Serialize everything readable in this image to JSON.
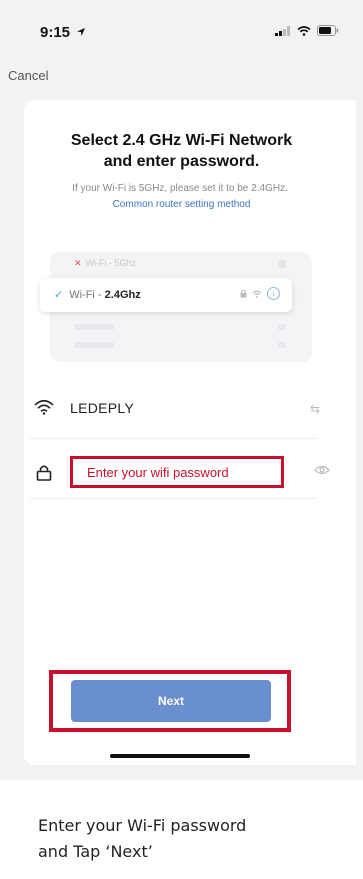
{
  "status_bar": {
    "time": "9:15",
    "location_icon": "location-arrow-icon",
    "signal_icon": "cellular-signal-icon",
    "wifi_icon": "wifi-icon",
    "battery_icon": "battery-icon"
  },
  "nav": {
    "cancel_label": "Cancel"
  },
  "header": {
    "title_line1": "Select 2.4 GHz Wi-Fi Network",
    "title_line2": "and enter password.",
    "subtitle": "If your Wi-Fi is 5GHz, please set it to be 2.4GHz.",
    "router_link": "Common router setting method"
  },
  "illustration": {
    "row_5g_prefix": "Wi-Fi - ",
    "row_5g_band": "5Ghz",
    "row_24g_prefix": "Wi-Fi - ",
    "row_24g_band": "2.4Ghz"
  },
  "network": {
    "ssid": "LEDEPLY"
  },
  "password": {
    "placeholder": "Enter your wifi password"
  },
  "actions": {
    "next_label": "Next"
  },
  "caption": {
    "line1": "Enter your Wi-Fi password",
    "line2": "and Tap ‘Next’"
  },
  "colors": {
    "highlight_red": "#c8102e",
    "button_blue": "#6a8fce",
    "link_blue": "#3b74c7"
  }
}
